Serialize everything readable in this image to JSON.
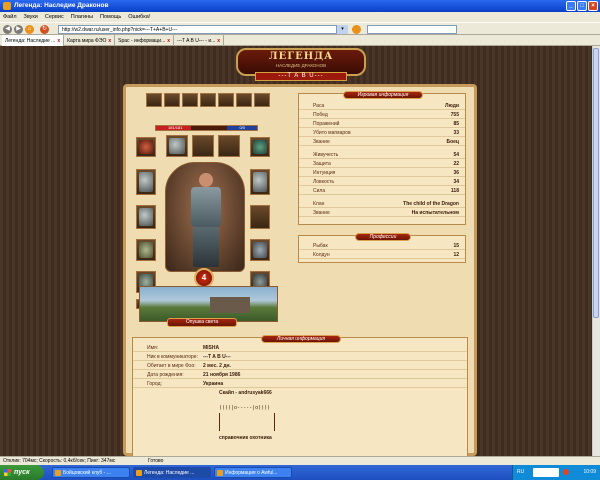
{
  "window": {
    "title": "Легенда: Наследие Драконов"
  },
  "menu": [
    "Файл",
    "Звуки",
    "Сервис",
    "Плагины",
    "Помощь",
    "Ошибка!"
  ],
  "toolbar": {
    "url": "http://w2.dwar.ru/user_info.php?nick=---T+A+B+U---"
  },
  "tabs": [
    {
      "label": "Легенда: Наследие ..."
    },
    {
      "label": "Карта мира ФЭО"
    },
    {
      "label": "Spac - информаци..."
    },
    {
      "label": "---T A B U--- - и..."
    }
  ],
  "header": {
    "logo": "ЛЕГЕНДА",
    "logo_sub": "НАСЛЕДИЕ ДРАКОНОВ",
    "nick": "---T A B U---"
  },
  "game_info": {
    "header": "Игровая информация",
    "stats": [
      {
        "k": "Раса",
        "v": "Люди"
      },
      {
        "k": "Побед",
        "v": "755"
      },
      {
        "k": "Поражений",
        "v": "85"
      },
      {
        "k": "Убито магмаров",
        "v": "33"
      },
      {
        "k": "Звание",
        "v": "Боец"
      },
      {
        "k": "Живучесть",
        "v": "54"
      },
      {
        "k": "Защита",
        "v": "22"
      },
      {
        "k": "Интуиция",
        "v": "36"
      },
      {
        "k": "Ловкость",
        "v": "34"
      },
      {
        "k": "Сила",
        "v": "118"
      },
      {
        "k": "Клан",
        "v": "The child of the Dragon"
      },
      {
        "k": "Звание",
        "v": "На испытательном"
      }
    ]
  },
  "professions": {
    "header": "Профессии",
    "items": [
      {
        "k": "Рыбак",
        "v": "15"
      },
      {
        "k": "Колдун",
        "v": "12"
      }
    ]
  },
  "character": {
    "level": "4",
    "location": "Опушка света",
    "hp": {
      "current": "181/181",
      "fill": 0.35
    },
    "mp": {
      "current": "0/0",
      "fill": 0.3
    }
  },
  "personal": {
    "header": "Личная информация",
    "rows": [
      {
        "k": "Имя:",
        "v": "MISHA"
      },
      {
        "k": "Ник в коммуникаторе:",
        "v": "---T A B U---"
      },
      {
        "k": "Обитает в мире Фэо:",
        "v": "2 мес. 2 дн."
      },
      {
        "k": "Дата рождения:",
        "v": "21 ноября 1986"
      },
      {
        "k": "Город:",
        "v": "Украина"
      }
    ],
    "skype": "Скайп - andrusyak666",
    "ascii": "((((|o-----|o))))",
    "footer": "справочник охотника"
  },
  "statusbar": {
    "text": "Отклик: 704мс; Скорость: 0,4кб/сек; Пинг: 347мс",
    "ready": "Готово"
  },
  "taskbar": {
    "start": "пуск",
    "items": [
      {
        "label": "Бойцовский клуб - ..."
      },
      {
        "label": "Легенда: Наследие ..."
      },
      {
        "label": "Информация о Awful..."
      }
    ],
    "lang": "RU",
    "clock": "10:09"
  }
}
